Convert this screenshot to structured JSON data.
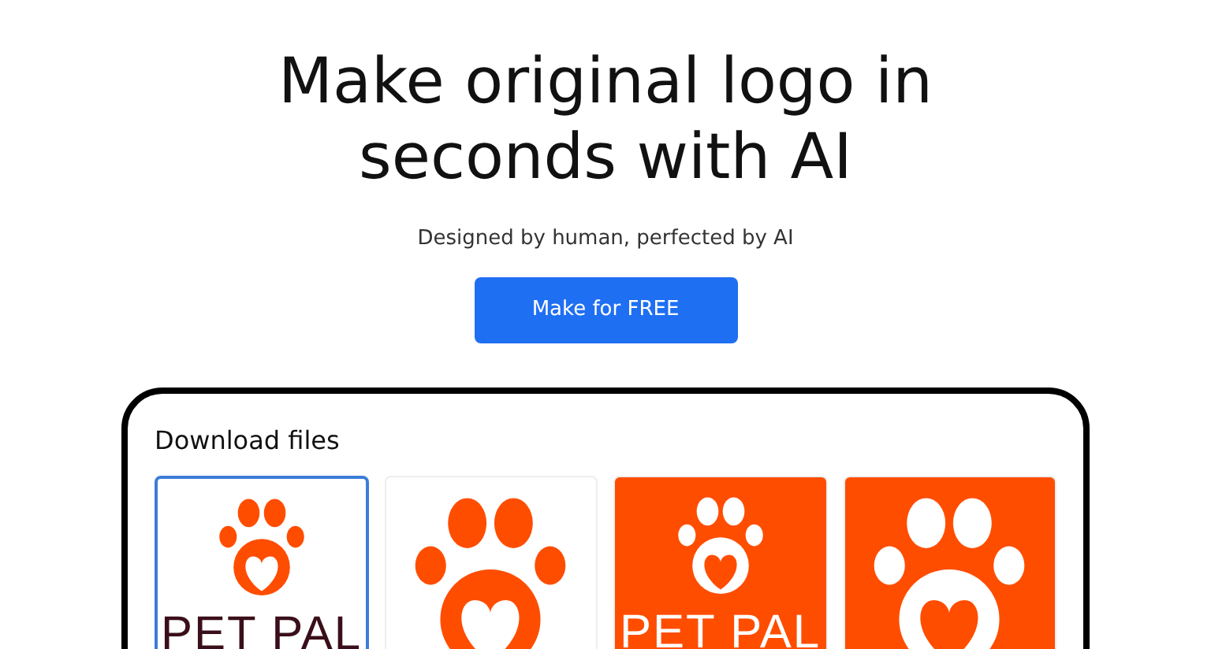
{
  "headline": "Make original logo in seconds with AI",
  "subtitle": "Designed by human, perfected by AI",
  "cta_button": "Make for FREE",
  "panel": {
    "title": "Download files",
    "logo_options": [
      {
        "kind": "light",
        "selected": true,
        "text": "PET PAL"
      },
      {
        "kind": "light",
        "selected": false
      },
      {
        "kind": "dark",
        "selected": false,
        "text": "PET PAL"
      },
      {
        "kind": "dark",
        "selected": false
      }
    ]
  }
}
